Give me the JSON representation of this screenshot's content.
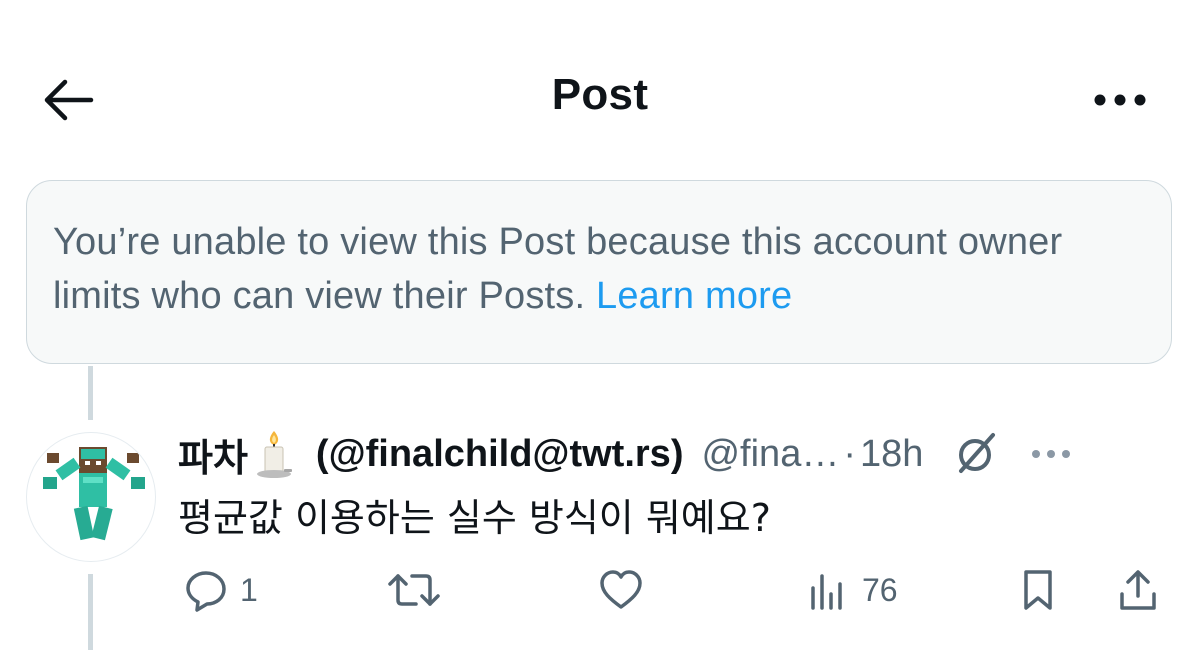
{
  "header": {
    "title": "Post",
    "back_icon": "arrow-left-icon",
    "more_icon": "more-horizontal-icon"
  },
  "notice": {
    "text": "You’re unable to view this Post because this account owner limits who can view their Posts.",
    "link_label": "Learn more"
  },
  "reply": {
    "display_name": "파차",
    "name_emoji": "candle-icon",
    "handle_full": "(@finalchild@twt.rs)",
    "handle_truncated": "@fina…",
    "separator": "·",
    "time": "18h",
    "text": "평균값 이용하는 실수 방식이 뭐예요?",
    "actions": {
      "reply_count": "1",
      "repost_count": "",
      "like_count": "",
      "views_count": "76"
    }
  },
  "colors": {
    "text_primary": "#0f1419",
    "text_secondary": "#536471",
    "link": "#1d9bf0",
    "notice_bg": "#f7f9f9",
    "border": "#cfd9de",
    "avatar_figure": "#2fbfa4"
  }
}
